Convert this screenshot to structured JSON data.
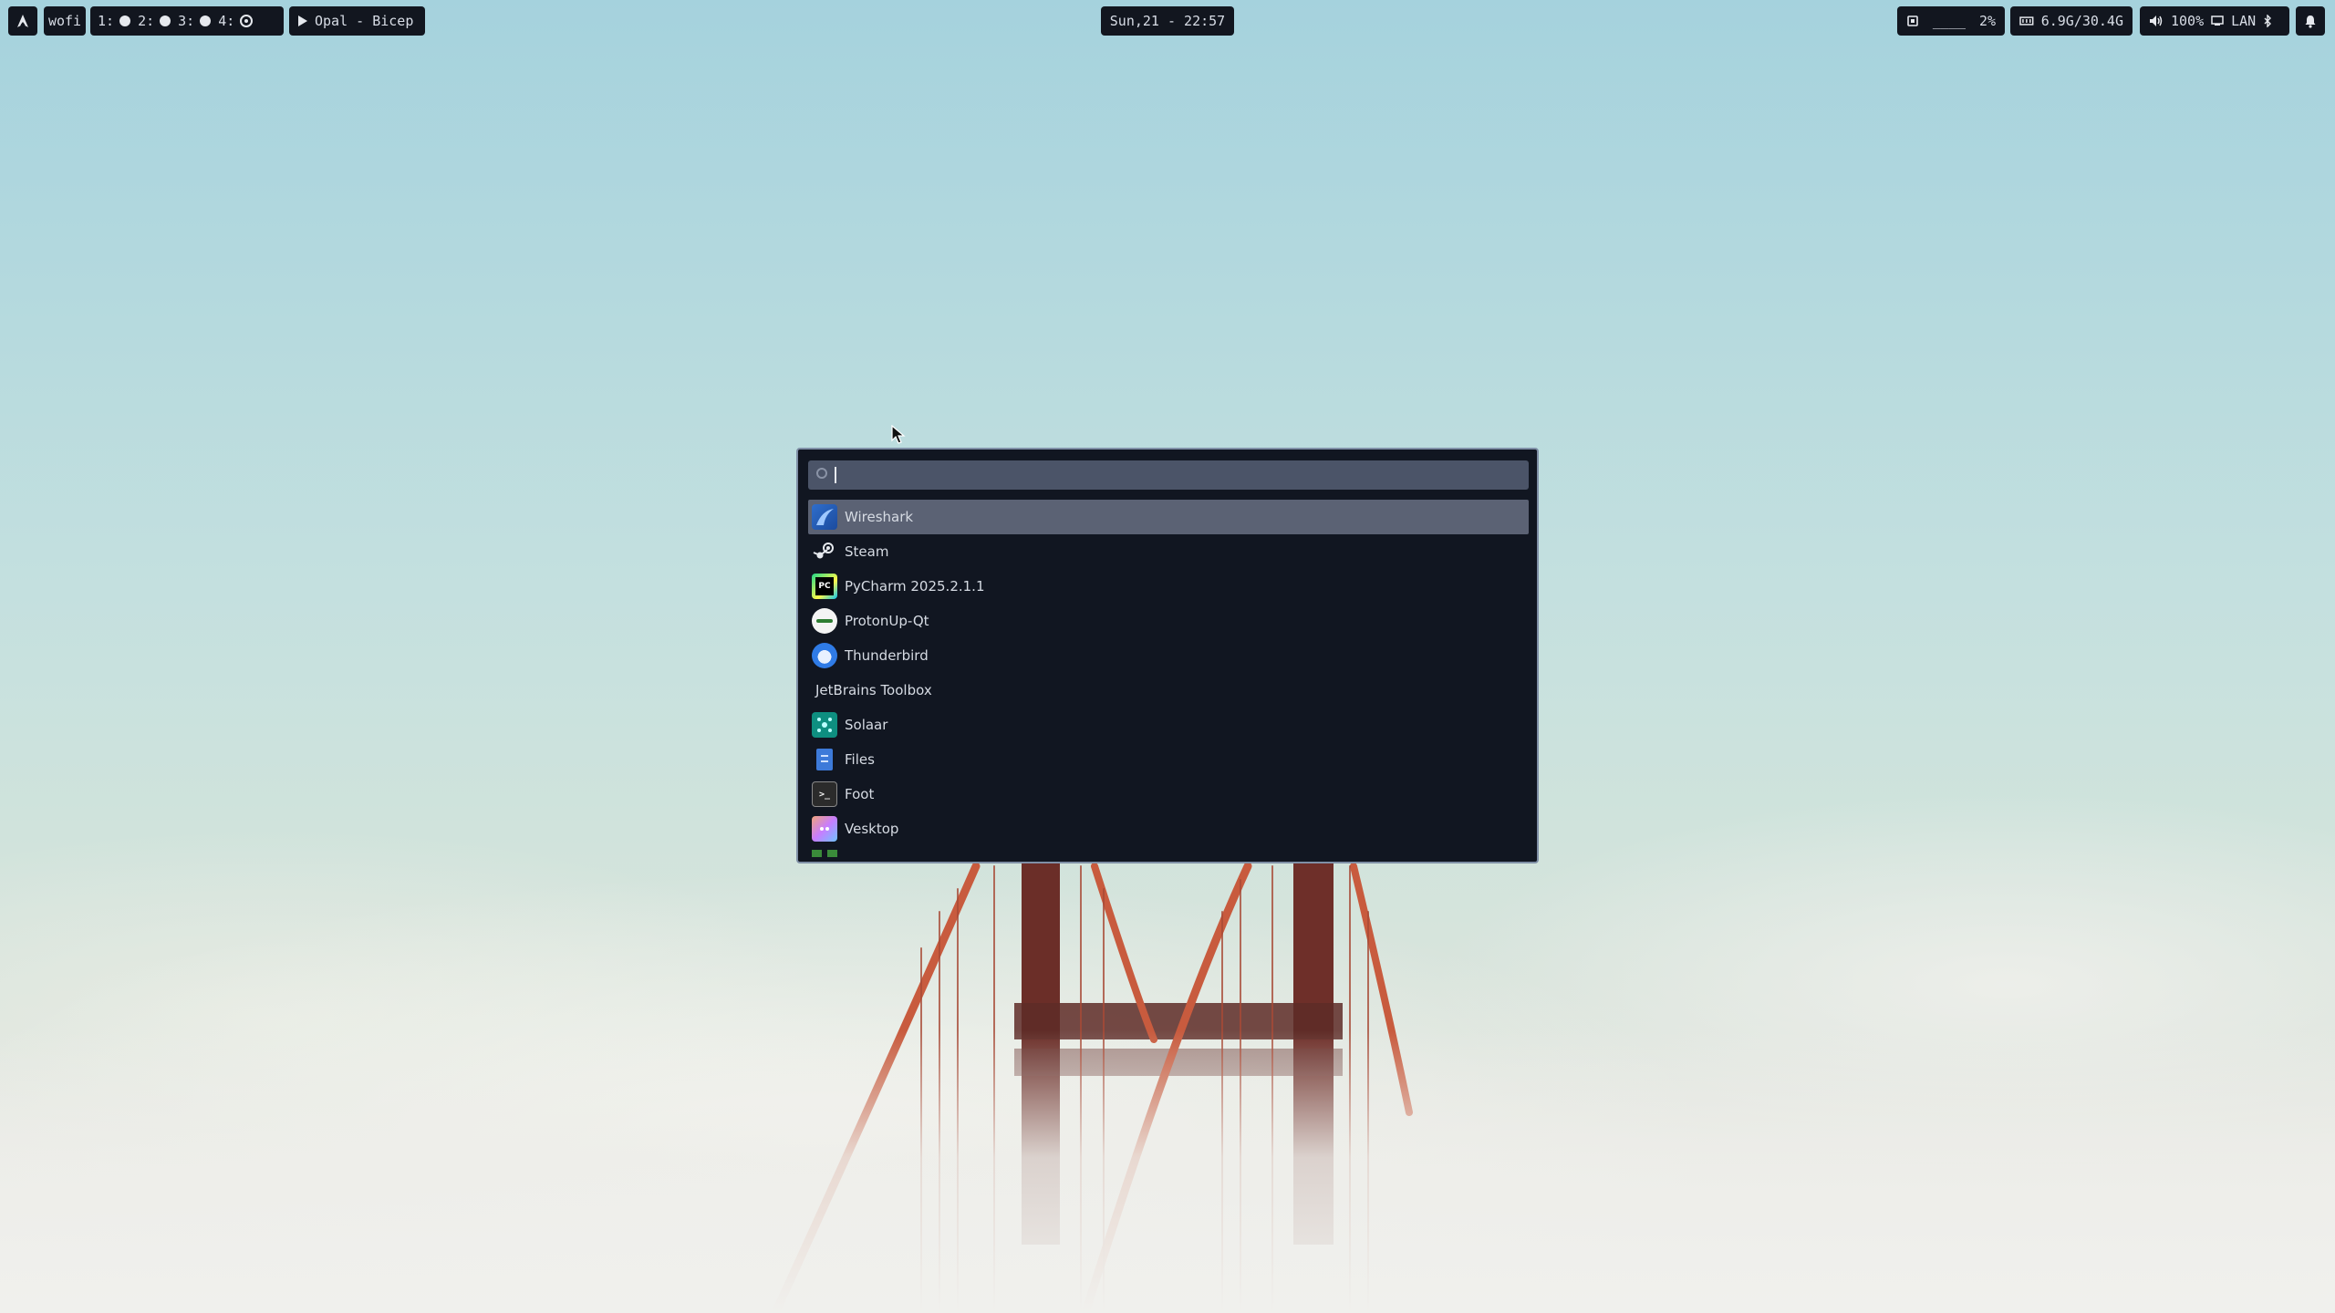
{
  "topbar": {
    "launcher_label": "wofi",
    "workspaces": [
      {
        "label": "1:"
      },
      {
        "label": "2:"
      },
      {
        "label": "3:"
      },
      {
        "label": "4:"
      }
    ],
    "media": "Opal - Bicep",
    "clock": "Sun,21 - 22:57",
    "cpu": {
      "bars": "____",
      "percent": "2%"
    },
    "memory": "6.9G/30.4G",
    "volume": "100%",
    "network": "LAN"
  },
  "launcher": {
    "search_value": "",
    "items": [
      {
        "label": "Wireshark",
        "icon": "wireshark-icon",
        "selected": true
      },
      {
        "label": "Steam",
        "icon": "steam-icon"
      },
      {
        "label": "PyCharm 2025.2.1.1",
        "icon": "pycharm-icon"
      },
      {
        "label": "ProtonUp-Qt",
        "icon": "protonup-icon"
      },
      {
        "label": "Thunderbird",
        "icon": "thunderbird-icon"
      },
      {
        "label": "JetBrains Toolbox",
        "icon": null
      },
      {
        "label": "Solaar",
        "icon": "solaar-icon"
      },
      {
        "label": "Files",
        "icon": "files-icon"
      },
      {
        "label": "Foot",
        "icon": "terminal-icon"
      },
      {
        "label": "Vesktop",
        "icon": "vesktop-icon"
      }
    ],
    "pycharm_icon_text": "PC",
    "foot_icon_text": ">_"
  },
  "colors": {
    "bar_bg": "#12161f",
    "launcher_bg": "#111621",
    "selection": "#5b6274",
    "border": "#7f8fa6"
  }
}
